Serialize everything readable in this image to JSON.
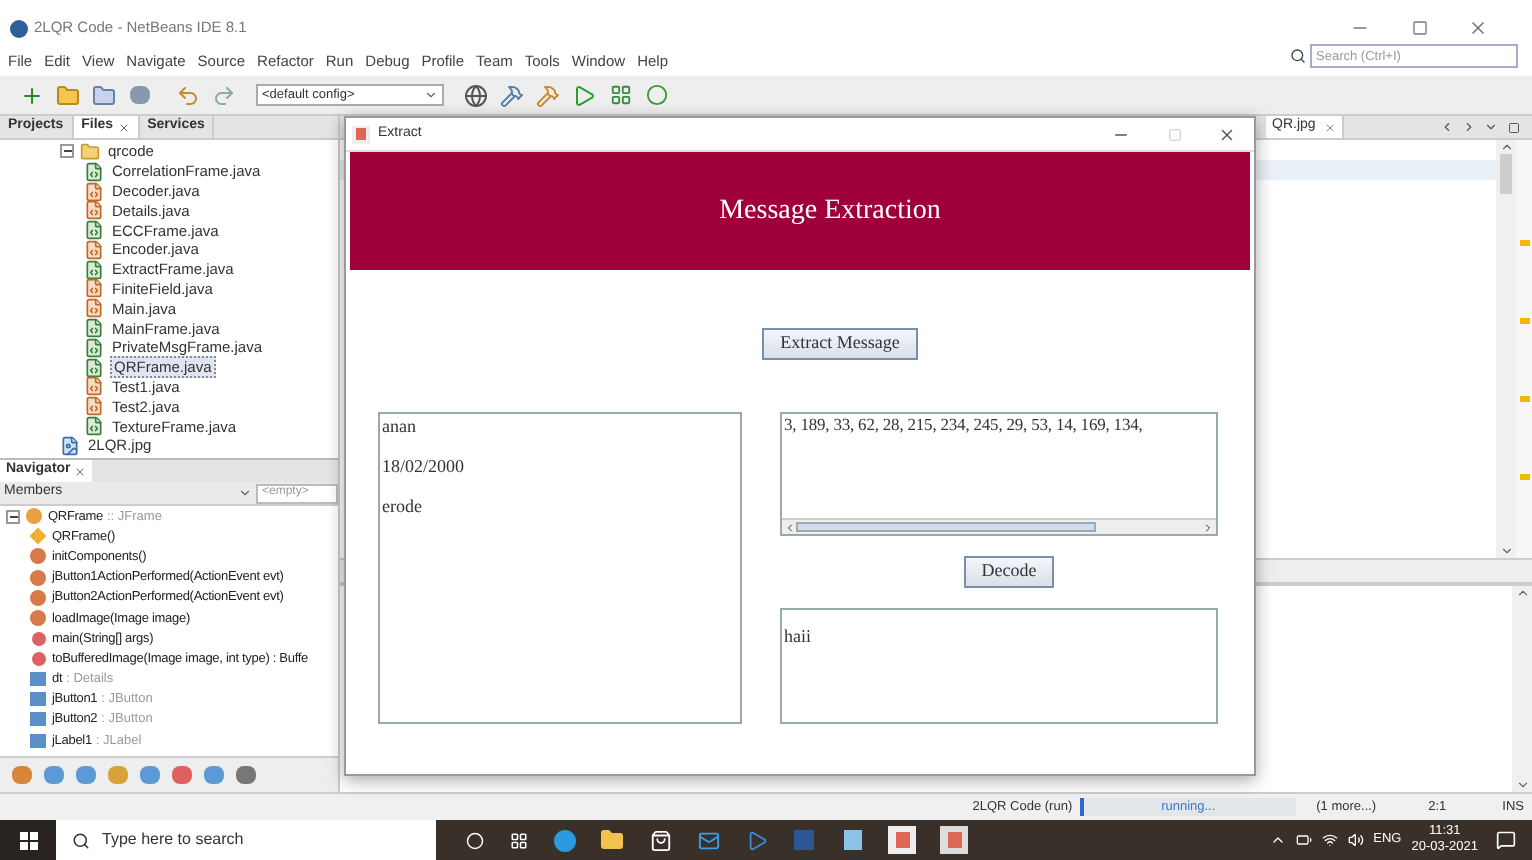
{
  "window": {
    "title": "2LQR Code - NetBeans IDE 8.1"
  },
  "menu": [
    "File",
    "Edit",
    "View",
    "Navigate",
    "Source",
    "Refactor",
    "Run",
    "Debug",
    "Profile",
    "Team",
    "Tools",
    "Window",
    "Help"
  ],
  "search": {
    "placeholder": "Search (Ctrl+I)"
  },
  "toolbar": {
    "config": "<default config>"
  },
  "projects_panel": {
    "tabs": [
      {
        "label": "Projects",
        "selected": false,
        "closable": false
      },
      {
        "label": "Files",
        "selected": true,
        "closable": true
      },
      {
        "label": "Services",
        "selected": false,
        "closable": false
      }
    ],
    "tree": [
      {
        "label": "qrcode",
        "kind": "folder",
        "expanded": true,
        "selected": false,
        "children": [
          {
            "label": "CorrelationFrame.java",
            "kind": "form",
            "selected": false
          },
          {
            "label": "Decoder.java",
            "kind": "class",
            "selected": false
          },
          {
            "label": "Details.java",
            "kind": "class",
            "selected": false
          },
          {
            "label": "ECCFrame.java",
            "kind": "form",
            "selected": false
          },
          {
            "label": "Encoder.java",
            "kind": "class",
            "selected": false
          },
          {
            "label": "ExtractFrame.java",
            "kind": "form",
            "selected": false
          },
          {
            "label": "FiniteField.java",
            "kind": "class",
            "selected": false
          },
          {
            "label": "Main.java",
            "kind": "class",
            "selected": false
          },
          {
            "label": "MainFrame.java",
            "kind": "form",
            "selected": false
          },
          {
            "label": "PrivateMsgFrame.java",
            "kind": "form",
            "selected": false
          },
          {
            "label": "QRFrame.java",
            "kind": "form",
            "selected": true
          },
          {
            "label": "Test1.java",
            "kind": "class",
            "selected": false
          },
          {
            "label": "Test2.java",
            "kind": "class",
            "selected": false
          },
          {
            "label": "TextureFrame.java",
            "kind": "form",
            "selected": false
          }
        ]
      },
      {
        "label": "2LQR.jpg",
        "kind": "image",
        "selected": false
      }
    ]
  },
  "navigator": {
    "title": "Navigator",
    "filter": "Members",
    "scope": "<empty>",
    "tree": [
      {
        "label": "QRFrame",
        "type": ":: JFrame",
        "kind": "class",
        "expanded": true,
        "children": [
          {
            "label": "QRFrame()",
            "kind": "constructor"
          },
          {
            "label": "initComponents()",
            "kind": "method"
          },
          {
            "label": "jButton1ActionPerformed(ActionEvent evt)",
            "kind": "method"
          },
          {
            "label": "jButton2ActionPerformed(ActionEvent evt)",
            "kind": "method"
          },
          {
            "label": "loadImage(Image image)",
            "kind": "method"
          },
          {
            "label": "main(String[] args)",
            "kind": "static"
          },
          {
            "label": "toBufferedImage(Image image, int type) : Buffe",
            "kind": "static"
          },
          {
            "label": "dt",
            "type": ": Details",
            "kind": "field"
          },
          {
            "label": "jButton1",
            "type": ": JButton",
            "kind": "field"
          },
          {
            "label": "jButton2",
            "type": ": JButton",
            "kind": "field"
          },
          {
            "label": "jLabel1",
            "type": ": JLabel",
            "kind": "field"
          }
        ]
      }
    ]
  },
  "editor": {
    "tabs": [
      {
        "label": "QR.jpg",
        "selected": true
      }
    ]
  },
  "dialog": {
    "title": "Extract",
    "heading": "Message Extraction",
    "extract_button": "Extract Message",
    "details_lines": [
      "anan",
      "18/02/2000",
      "erode"
    ],
    "encoded_text": "3, 189, 33, 62, 28, 215, 234, 245, 29, 53, 14, 169, 134,",
    "decode_button": "Decode",
    "output_text": "haii"
  },
  "status_bar": {
    "task": "2LQR Code (run)",
    "progress": {
      "label": "running...",
      "level": 0.02
    },
    "more": "(1 more...)",
    "position": "2:1",
    "mode": "INS"
  },
  "taskbar": {
    "search_placeholder": "Type here to search",
    "language": "ENG",
    "time": "11:31",
    "date": "20-03-2021"
  }
}
